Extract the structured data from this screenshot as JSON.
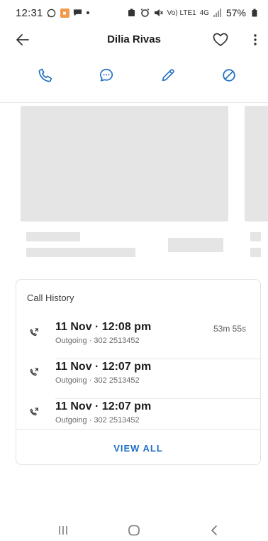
{
  "status_bar": {
    "time": "12:31",
    "battery": "57%",
    "icons": [
      "whatsapp-icon",
      "notification-badge-icon",
      "chat-icon",
      "dot-icon",
      "battery-saver-icon",
      "alarm-icon",
      "mute-icon",
      "volte-icon",
      "signal-icon",
      "battery-icon"
    ],
    "small_1": "Vo) LTE1",
    "small_2": "4G"
  },
  "header": {
    "title": "Dilia Rivas"
  },
  "actions": [
    {
      "name": "call",
      "icon": "phone-icon"
    },
    {
      "name": "message",
      "icon": "message-icon"
    },
    {
      "name": "edit",
      "icon": "pencil-icon"
    },
    {
      "name": "block",
      "icon": "block-icon"
    }
  ],
  "colors": {
    "accent": "#1f6fc3",
    "placeholder": "#e5e5e5"
  },
  "call_history": {
    "title": "Call History",
    "items": [
      {
        "main": "11 Nov · 12:08 pm",
        "sub": "Outgoing · 302 2513452",
        "duration": "53m 55s"
      },
      {
        "main": "11 Nov · 12:07 pm",
        "sub": "Outgoing · 302 2513452",
        "duration": ""
      },
      {
        "main": "11 Nov · 12:07 pm",
        "sub": "Outgoing · 302 2513452",
        "duration": ""
      }
    ],
    "view_all": "VIEW ALL"
  }
}
